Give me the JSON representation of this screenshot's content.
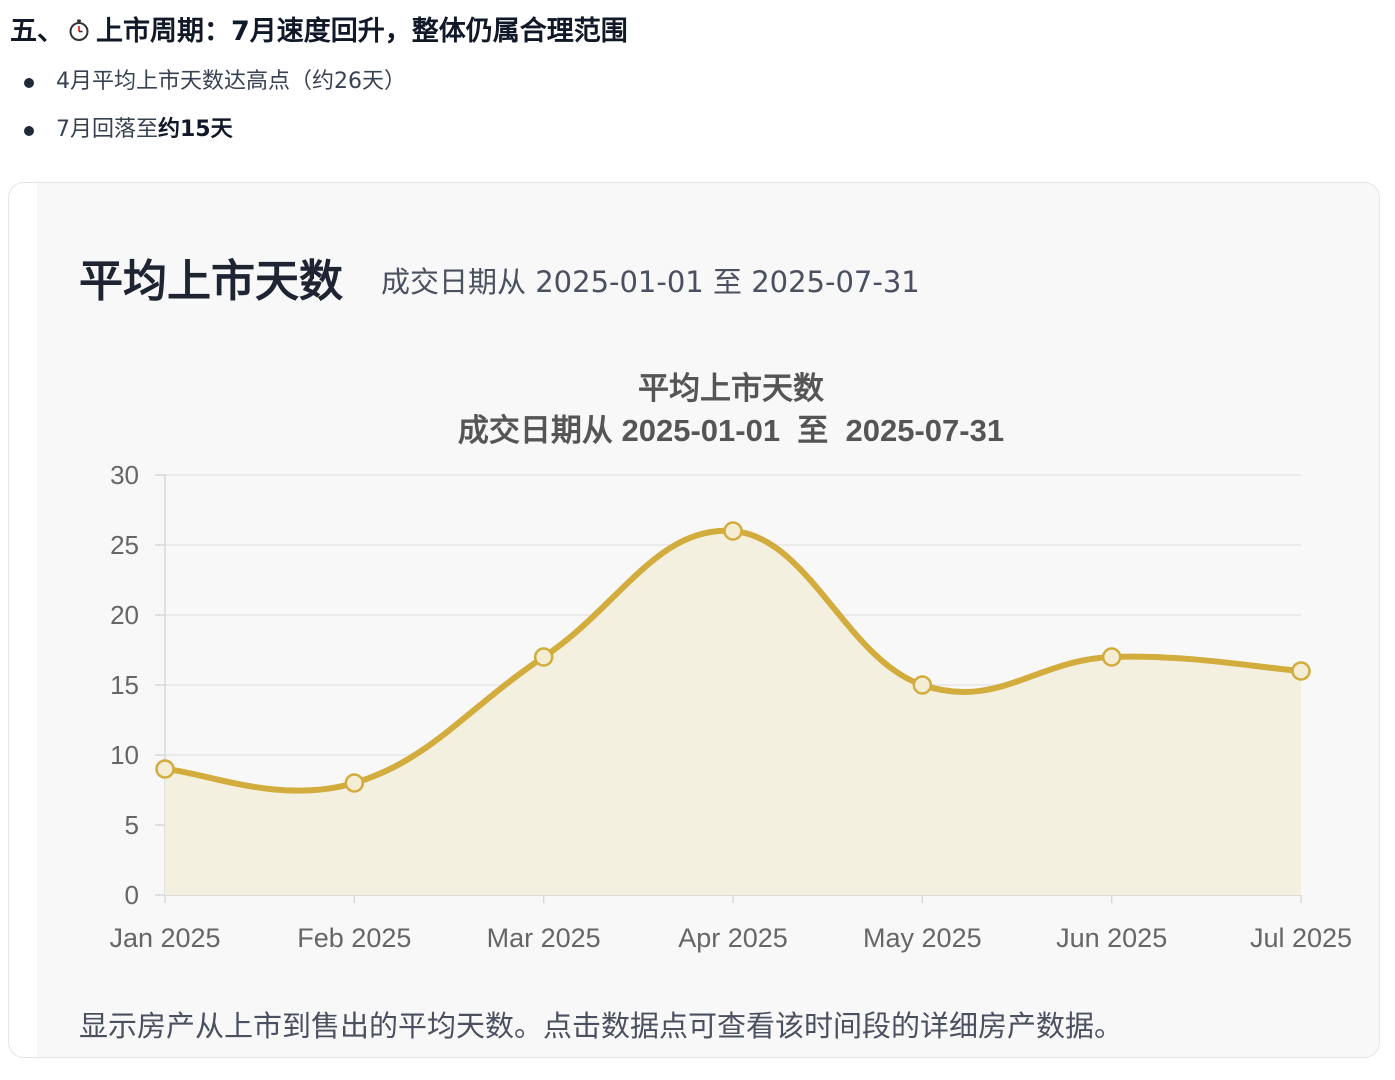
{
  "section": {
    "heading_prefix": "五、",
    "heading_text": "上市周期：7月速度回升，整体仍属合理范围",
    "icon": "stopwatch-icon"
  },
  "bullets": [
    {
      "text": "4月平均上市天数达高点（约26天）"
    },
    {
      "text_prefix": "7月回落至",
      "text_bold": "约15天"
    }
  ],
  "card": {
    "title": "平均上市天数",
    "subtitle": "成交日期从 2025-01-01 至 2025-07-31",
    "description": "显示房产从上市到售出的平均天数。点击数据点可查看该时间段的详细房产数据。"
  },
  "chart_data": {
    "type": "line",
    "title": "平均上市天数",
    "subtitle": "成交日期从 2025-01-01  至  2025-07-31",
    "categories": [
      "Jan 2025",
      "Feb 2025",
      "Mar 2025",
      "Apr 2025",
      "May 2025",
      "Jun 2025",
      "Jul 2025"
    ],
    "series": [
      {
        "values": [
          9,
          8,
          17,
          26,
          15,
          17,
          16
        ],
        "color": "#d2ac3d",
        "fill": "#f4f0e0"
      }
    ],
    "ylim": [
      0,
      30
    ],
    "yticks": [
      "0",
      "5",
      "10",
      "15",
      "20",
      "25",
      "30"
    ],
    "grid": true,
    "smooth": true,
    "legend": false,
    "xlabel": "",
    "ylabel": ""
  }
}
